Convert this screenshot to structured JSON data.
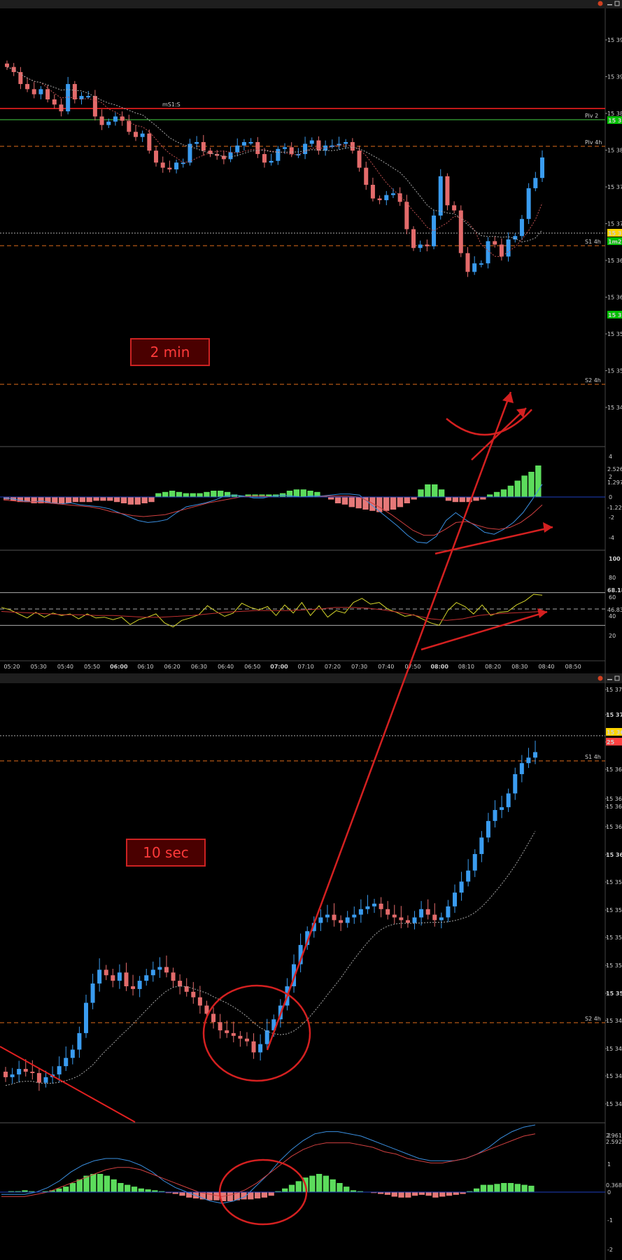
{
  "chart_data": [
    {
      "type": "candlestick",
      "timeframe_label": "2 min",
      "time_ticks": [
        "05:20",
        "05:30",
        "05:40",
        "05:50",
        "06:00",
        "06:10",
        "06:20",
        "06:30",
        "06:40",
        "06:50",
        "07:00",
        "07:10",
        "07:20",
        "07:30",
        "07:40",
        "07:50",
        "08:00",
        "08:10",
        "08:20",
        "08:30",
        "08:40",
        "08:50"
      ],
      "time_ticks_bold": [
        "06:00",
        "07:00",
        "08:00"
      ],
      "price_ticks": [
        "15 39",
        "15 39",
        "15 38",
        "15 38",
        "15 37",
        "15 37",
        "15 36",
        "15 36",
        "15 35",
        "15 35",
        "15 34"
      ],
      "price_axis_tags": [
        {
          "text": "15 38",
          "color": "#00c000"
        },
        {
          "text": "15 36",
          "color": "#ffd400"
        },
        {
          "text": "1m25",
          "color": "#00c000"
        },
        {
          "text": "15 35",
          "color": "#00c000"
        }
      ],
      "levels": [
        {
          "name": "mS1:S",
          "color": "#ff2020",
          "style": "solid",
          "label_pos": "center"
        },
        {
          "name": "Piv 2",
          "color": "#2e8b2e",
          "style": "solid",
          "label_pos": "right"
        },
        {
          "name": "Piv 4h",
          "color": "#e06c1a",
          "style": "dashed",
          "label_pos": "right"
        },
        {
          "name": "S1 4h",
          "color": "#e06c1a",
          "style": "dashed",
          "label_pos": "right"
        },
        {
          "name": "S2 4h",
          "color": "#e06c1a",
          "style": "dashed",
          "label_pos": "right"
        }
      ],
      "price_series": [
        15.3838,
        15.3832,
        15.3818,
        15.3812,
        15.3806,
        15.3812,
        15.38,
        15.3794,
        15.3786,
        15.3818,
        15.38,
        15.3804,
        15.3804,
        15.378,
        15.377,
        15.3774,
        15.378,
        15.3775,
        15.3762,
        15.3756,
        15.376,
        15.374,
        15.3726,
        15.372,
        15.3718,
        15.3726,
        15.3726,
        15.3748,
        15.375,
        15.374,
        15.3736,
        15.3734,
        15.373,
        15.3738,
        15.3746,
        15.375,
        15.375,
        15.3736,
        15.3726,
        15.3728,
        15.3742,
        15.3744,
        15.3736,
        15.3736,
        15.3748,
        15.3752,
        15.374,
        15.3746,
        15.3746,
        15.3748,
        15.375,
        15.374,
        15.372,
        15.37,
        15.3684,
        15.3682,
        15.3688,
        15.369,
        15.368,
        15.3648,
        15.3626,
        15.363,
        15.3628,
        15.3664,
        15.371,
        15.3676,
        15.367,
        15.362,
        15.3598,
        15.3608,
        15.3608,
        15.3634,
        15.363,
        15.3616,
        15.3636,
        15.364,
        15.366,
        15.3696,
        15.3708,
        15.3732
      ],
      "macd": {
        "axis_ticks": [
          "4",
          "2",
          "0",
          "-2",
          "-4"
        ],
        "axis_tags": [
          {
            "text": "2.526",
            "color": "#33cc33"
          },
          {
            "text": "1.297",
            "color": "#4da3ff"
          },
          {
            "text": "-1.229",
            "color": "#ff4040"
          }
        ],
        "histogram": [
          -0.2,
          -0.3,
          -0.4,
          -0.4,
          -0.5,
          -0.5,
          -0.5,
          -0.5,
          -0.5,
          -0.5,
          -0.4,
          -0.4,
          -0.4,
          -0.3,
          -0.3,
          -0.3,
          -0.4,
          -0.5,
          -0.6,
          -0.6,
          -0.5,
          -0.4,
          0.3,
          0.4,
          0.5,
          0.4,
          0.3,
          0.3,
          0.3,
          0.4,
          0.5,
          0.5,
          0.4,
          0.2,
          0.1,
          0.2,
          0.2,
          0.2,
          0.2,
          0.2,
          0.3,
          0.5,
          0.6,
          0.6,
          0.5,
          0.4,
          0.1,
          -0.2,
          -0.5,
          -0.6,
          -0.8,
          -0.9,
          -1.0,
          -1.1,
          -1.2,
          -1.1,
          -1.0,
          -0.8,
          -0.5,
          -0.2,
          0.6,
          1.0,
          1.0,
          0.6,
          -0.3,
          -0.4,
          -0.4,
          -0.4,
          -0.3,
          -0.2,
          0.2,
          0.4,
          0.6,
          0.9,
          1.3,
          1.7,
          2.0,
          2.5
        ],
        "macd_line": [
          -0.1,
          -0.2,
          -0.4,
          -0.5,
          -0.4,
          -0.6,
          -0.7,
          -0.6,
          -0.8,
          -0.9,
          -1.0,
          -1.2,
          -1.6,
          -2.0,
          -2.4,
          -2.6,
          -2.5,
          -2.3,
          -1.6,
          -1.0,
          -0.8,
          -0.6,
          -0.3,
          0.1,
          0.2,
          0.1,
          -0.1,
          -0.1,
          0.1,
          0.2,
          0.1,
          0.0,
          0.1,
          0.1,
          0.2,
          0.3,
          0.3,
          0.2,
          -0.6,
          -1.4,
          -2.2,
          -3.0,
          -3.9,
          -4.6,
          -4.7,
          -4.0,
          -2.4,
          -1.6,
          -2.3,
          -2.9,
          -3.6,
          -3.8,
          -3.3,
          -2.6,
          -1.6,
          -0.2,
          1.3
        ],
        "signal_line": [
          -0.3,
          -0.4,
          -0.5,
          -0.5,
          -0.6,
          -0.7,
          -0.8,
          -0.9,
          -1.0,
          -1.2,
          -1.5,
          -1.7,
          -1.9,
          -2.0,
          -1.9,
          -1.8,
          -1.5,
          -1.2,
          -0.9,
          -0.6,
          -0.4,
          -0.2,
          0.0,
          0.1,
          0.1,
          0.0,
          0.0,
          0.0,
          0.0,
          0.0,
          0.1,
          0.1,
          0.1,
          0.0,
          -0.5,
          -1.1,
          -1.8,
          -2.6,
          -3.4,
          -3.9,
          -3.9,
          -3.3,
          -2.6,
          -2.5,
          -2.9,
          -3.2,
          -3.3,
          -3.1,
          -2.6,
          -1.8,
          -0.8
        ]
      },
      "rsi": {
        "axis_ticks": [
          "100",
          "80",
          "60",
          "40",
          "20"
        ],
        "axis_tags": [
          {
            "text": "68.18",
            "color": "#ffd400"
          },
          {
            "text": "46.83",
            "color": "#ff4040"
          }
        ],
        "levels": [
          70,
          50,
          30
        ],
        "rsi_line": [
          52,
          49,
          44,
          39,
          46,
          40,
          45,
          42,
          44,
          38,
          44,
          39,
          40,
          37,
          40,
          31,
          37,
          40,
          44,
          33,
          28,
          36,
          39,
          43,
          54,
          47,
          41,
          45,
          57,
          52,
          49,
          53,
          42,
          55,
          45,
          58,
          42,
          54,
          40,
          48,
          45,
          58,
          63,
          56,
          58,
          50,
          46,
          41,
          43,
          38,
          33,
          30,
          48,
          58,
          53,
          44,
          55,
          42,
          46,
          47,
          55,
          60,
          68,
          67
        ],
        "ma_line": [
          47,
          46,
          45,
          44,
          43,
          43,
          42,
          42,
          41,
          40,
          40,
          41,
          42,
          44,
          46,
          47,
          48,
          48,
          48,
          49,
          50,
          52,
          52,
          51,
          49,
          46,
          42,
          38,
          36,
          38,
          42,
          44,
          45,
          46,
          47
        ]
      }
    },
    {
      "type": "candlestick",
      "timeframe_label": "10 sec",
      "price_ticks": [
        "15 372",
        "15 370",
        "15 368",
        "15 366",
        "15 364",
        "15 363",
        "15 362",
        "15 360",
        "15 358",
        "15 356",
        "15 354",
        "15 352",
        "15 350",
        "15 348",
        "15 346",
        "15 344",
        "15 342"
      ],
      "price_axis_tags": [
        {
          "text": "15 36",
          "color": "#ffd400"
        },
        {
          "text": "25",
          "color": "#ff4040"
        }
      ],
      "levels": [
        {
          "name": "S1 4h",
          "color": "#e06c1a",
          "style": "dashed",
          "label_pos": "right"
        },
        {
          "name": "S2 4h",
          "color": "#e06c1a",
          "style": "dashed",
          "label_pos": "right"
        }
      ],
      "price_series": [
        15.3444,
        15.3446,
        15.345,
        15.3448,
        15.3447,
        15.344,
        15.3444,
        15.3446,
        15.3452,
        15.3458,
        15.3464,
        15.3476,
        15.3498,
        15.3512,
        15.3522,
        15.3518,
        15.3514,
        15.352,
        15.351,
        15.3508,
        15.3514,
        15.3518,
        15.3522,
        15.3524,
        15.352,
        15.3514,
        15.351,
        15.3506,
        15.3502,
        15.3496,
        15.349,
        15.3484,
        15.3478,
        15.3476,
        15.3474,
        15.3472,
        15.347,
        15.3462,
        15.3468,
        15.3478,
        15.3486,
        15.3496,
        15.351,
        15.3526,
        15.354,
        15.355,
        15.3556,
        15.356,
        15.3562,
        15.3558,
        15.3556,
        15.356,
        15.3562,
        15.3566,
        15.3568,
        15.357,
        15.3566,
        15.3562,
        15.356,
        15.3558,
        15.3556,
        15.356,
        15.3566,
        15.3562,
        15.3558,
        15.356,
        15.3568,
        15.3578,
        15.3586,
        15.3594,
        15.3606,
        15.3618,
        15.363,
        15.3638,
        15.364,
        15.365,
        15.3664,
        15.3672,
        15.3676,
        15.368
      ],
      "macd": {
        "axis_ticks": [
          "2",
          "1",
          "0",
          "-1",
          "-2"
        ],
        "axis_tags": [
          {
            "text": "2.961",
            "color": "#4da3ff"
          },
          {
            "text": "2.592",
            "color": "#ff4040"
          },
          {
            "text": "0.368",
            "color": "#33cc33"
          }
        ],
        "histogram": [
          0,
          0.05,
          0.05,
          0.1,
          0.05,
          0,
          0.05,
          0.1,
          0.2,
          0.3,
          0.5,
          0.7,
          0.9,
          1.0,
          1.0,
          0.9,
          0.7,
          0.5,
          0.4,
          0.3,
          0.2,
          0.15,
          0.1,
          0.05,
          -0.05,
          -0.1,
          -0.2,
          -0.3,
          -0.35,
          -0.4,
          -0.45,
          -0.45,
          -0.5,
          -0.5,
          -0.45,
          -0.4,
          -0.4,
          -0.35,
          -0.3,
          -0.2,
          0.05,
          0.2,
          0.4,
          0.6,
          0.8,
          0.9,
          1.0,
          0.9,
          0.7,
          0.5,
          0.3,
          0.1,
          0.05,
          0,
          -0.05,
          -0.1,
          -0.15,
          -0.25,
          -0.3,
          -0.3,
          -0.2,
          -0.15,
          -0.2,
          -0.3,
          -0.25,
          -0.2,
          -0.15,
          -0.1,
          0.05,
          0.2,
          0.4,
          0.4,
          0.45,
          0.5,
          0.5,
          0.45,
          0.4,
          0.35
        ],
        "macd_line": [
          -0.1,
          -0.1,
          -0.1,
          0.0,
          0.2,
          0.5,
          0.9,
          1.2,
          1.4,
          1.5,
          1.5,
          1.4,
          1.2,
          0.9,
          0.5,
          0.2,
          0.0,
          -0.2,
          -0.4,
          -0.5,
          -0.4,
          -0.2,
          0.3,
          0.8,
          1.4,
          1.9,
          2.3,
          2.6,
          2.7,
          2.7,
          2.6,
          2.5,
          2.3,
          2.1,
          1.9,
          1.7,
          1.5,
          1.4,
          1.4,
          1.4,
          1.5,
          1.7,
          2.0,
          2.4,
          2.7,
          2.9,
          3.0
        ],
        "signal_line": [
          -0.2,
          -0.2,
          -0.2,
          -0.1,
          0.0,
          0.2,
          0.4,
          0.6,
          0.8,
          1.0,
          1.1,
          1.1,
          1.0,
          0.8,
          0.6,
          0.4,
          0.2,
          0.0,
          -0.1,
          -0.2,
          -0.1,
          0.1,
          0.4,
          0.8,
          1.2,
          1.6,
          1.9,
          2.1,
          2.2,
          2.2,
          2.2,
          2.1,
          2.0,
          1.8,
          1.7,
          1.5,
          1.4,
          1.3,
          1.3,
          1.4,
          1.5,
          1.7,
          1.9,
          2.1,
          2.3,
          2.5,
          2.6
        ]
      }
    }
  ]
}
